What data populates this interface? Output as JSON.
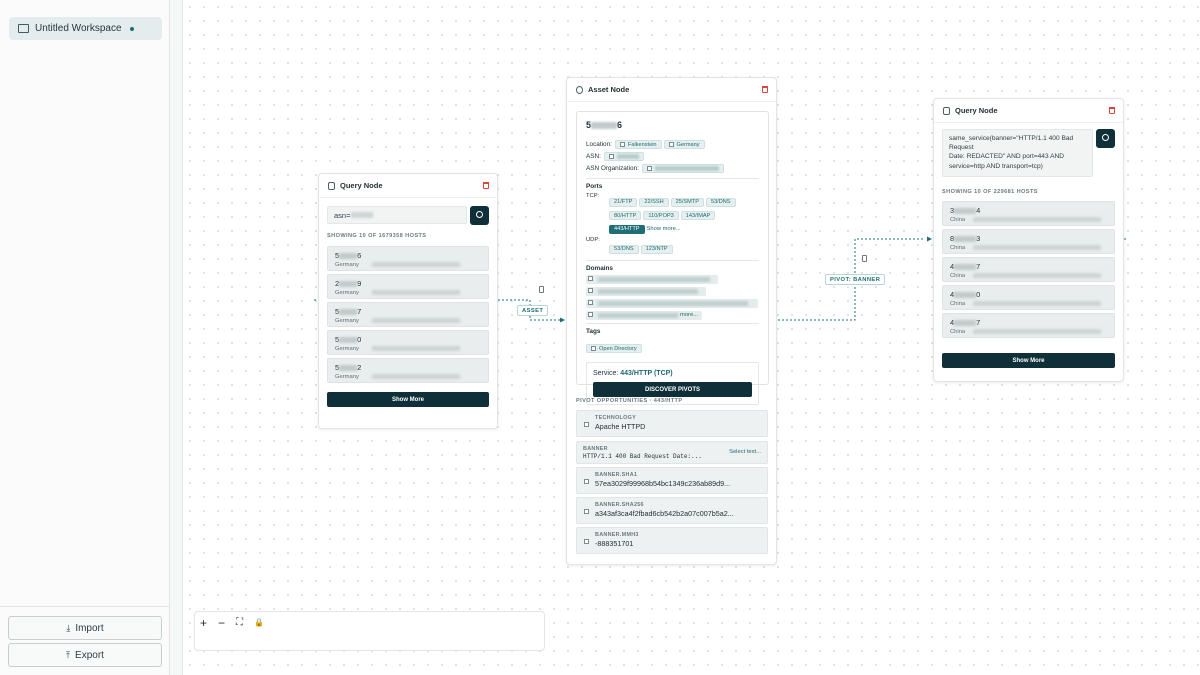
{
  "sidebar": {
    "workspace_label": "Untitled Workspace",
    "import_label": "Import",
    "export_label": "Export"
  },
  "left_query": {
    "title": "Query Node",
    "search_value": "asn=",
    "results_label": "SHOWING 10 OF 1679358 HOSTS",
    "hosts": [
      {
        "ip_start": "5",
        "ip_end": "6",
        "country": "Germany"
      },
      {
        "ip_start": "2",
        "ip_end": "9",
        "country": "Germany"
      },
      {
        "ip_start": "5",
        "ip_end": "7",
        "country": "Germany"
      },
      {
        "ip_start": "5",
        "ip_end": "0",
        "country": "Germany"
      },
      {
        "ip_start": "5",
        "ip_end": "2",
        "country": "Germany"
      }
    ],
    "show_more": "Show More"
  },
  "asset": {
    "title": "Asset Node",
    "ip_start": "5",
    "ip_end": "6",
    "location_label": "Location:",
    "location_city": "Falkenstein",
    "location_country": "Germany",
    "asn_label": "ASN:",
    "asn_org_label": "ASN Organization:",
    "ports_title": "Ports",
    "tcp_label": "TCP:",
    "tcp_ports": [
      "21/FTP",
      "22/SSH",
      "25/SMTP",
      "53/DNS",
      "80/HTTP",
      "110/POP3",
      "143/IMAP"
    ],
    "tcp_active": "443/HTTP",
    "show_more": "Show more...",
    "udp_label": "UDP:",
    "udp_ports": [
      "53/DNS",
      "123/NTP"
    ],
    "domains_title": "Domains",
    "domains_more": "more...",
    "tags_title": "Tags",
    "tag": "Open Directory",
    "service_label": "Service:",
    "service_value": "443/HTTP (TCP)",
    "discover_label": "DISCOVER PIVOTS",
    "pivot_title": "PIVOT OPPORTUNITIES · 443/HTTP",
    "pivots": [
      {
        "key": "TECHNOLOGY",
        "value": "Apache HTTPD"
      },
      {
        "key": "BANNER",
        "value": "HTTP/1.1 400 Bad Request Date:...",
        "action": "Select text..."
      },
      {
        "key": "BANNER.SHA1",
        "value": "57ea3029f99968b54bc1349c236ab89d9..."
      },
      {
        "key": "BANNER.SHA256",
        "value": "a343af3ca4f2fbad6cb542b2a07c007b5a2..."
      },
      {
        "key": "BANNER.MMH3",
        "value": "-888351701"
      }
    ]
  },
  "right_query": {
    "title": "Query Node",
    "query_text": "same_service(banner=\"HTTP/1.1 400 Bad Request\nDate: REDACTED\" AND port=443 AND service=http AND transport=tcp)",
    "results_label": "SHOWING 10 OF 229681 HOSTS",
    "hosts": [
      {
        "ip_start": "3",
        "ip_end": "4",
        "country": "China"
      },
      {
        "ip_start": "8",
        "ip_end": "3",
        "country": "China"
      },
      {
        "ip_start": "4",
        "ip_end": "7",
        "country": "China"
      },
      {
        "ip_start": "4",
        "ip_end": "0",
        "country": "China"
      },
      {
        "ip_start": "4",
        "ip_end": "7",
        "country": "China"
      }
    ],
    "show_more": "Show More"
  },
  "edges": {
    "asset_label": "ASSET",
    "pivot_label": "PIVOT: BANNER"
  },
  "controls": {
    "zoom_in": "+",
    "zoom_out": "−",
    "fit": "⛶",
    "lock": "🔒"
  }
}
